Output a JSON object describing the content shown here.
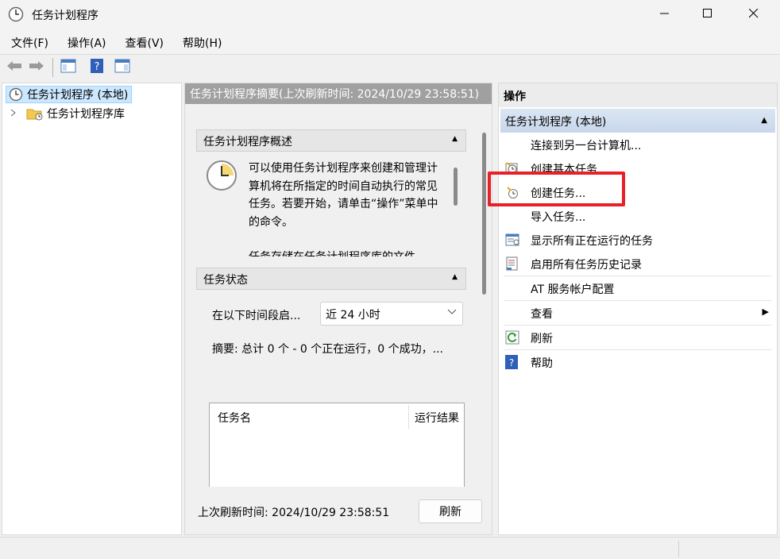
{
  "window": {
    "title": "任务计划程序",
    "app_icon": "clock-icon"
  },
  "menu": [
    "文件(F)",
    "操作(A)",
    "查看(V)",
    "帮助(H)"
  ],
  "toolbar": {
    "buttons": [
      "back-arrow-icon",
      "forward-arrow-icon",
      "console-tree-icon",
      "help-icon",
      "action-pane-icon"
    ]
  },
  "tree": {
    "root": "任务计划程序 (本地)",
    "child": "任务计划程序库"
  },
  "middle": {
    "header": "任务计划程序摘要(上次刷新时间: 2024/10/29 23:58:51)",
    "overview": {
      "title": "任务计划程序概述",
      "text": "可以使用任务计划程序来创建和管理计算机将在所指定的时间自动执行的常见任务。若要开始，请单击“操作”菜单中的命令。",
      "text2": "任务存储在任务计划程序库的文件"
    },
    "status": {
      "title": "任务状态",
      "period_label": "在以下时间段启...",
      "period_value": "近 24 小时",
      "summary": "摘要: 总计 0 个 - 0 个正在运行，0 个成功，...",
      "table_headers": [
        "任务名",
        "运行结果"
      ]
    },
    "footer": {
      "last_refresh": "上次刷新时间: 2024/10/29 23:58:51",
      "refresh_button": "刷新"
    }
  },
  "actions": {
    "title": "操作",
    "group": "任务计划程序 (本地)",
    "items": [
      {
        "label": "连接到另一台计算机...",
        "icon": ""
      },
      {
        "label": "创建基本任务...",
        "icon": "basic-task-icon"
      },
      {
        "label": "创建任务...",
        "icon": "create-task-icon"
      },
      {
        "label": "导入任务...",
        "icon": ""
      },
      {
        "label": "显示所有正在运行的任务",
        "icon": "running-tasks-icon"
      },
      {
        "label": "启用所有任务历史记录",
        "icon": "history-icon"
      },
      {
        "label": "AT 服务帐户配置",
        "icon": ""
      },
      {
        "label": "查看",
        "icon": ""
      },
      {
        "label": "刷新",
        "icon": "refresh-icon"
      },
      {
        "label": "帮助",
        "icon": "help-icon"
      }
    ]
  },
  "colors": {
    "highlight": "#e8202a",
    "selection": "#cce8ff",
    "mid_header": "#a0a0a0"
  }
}
